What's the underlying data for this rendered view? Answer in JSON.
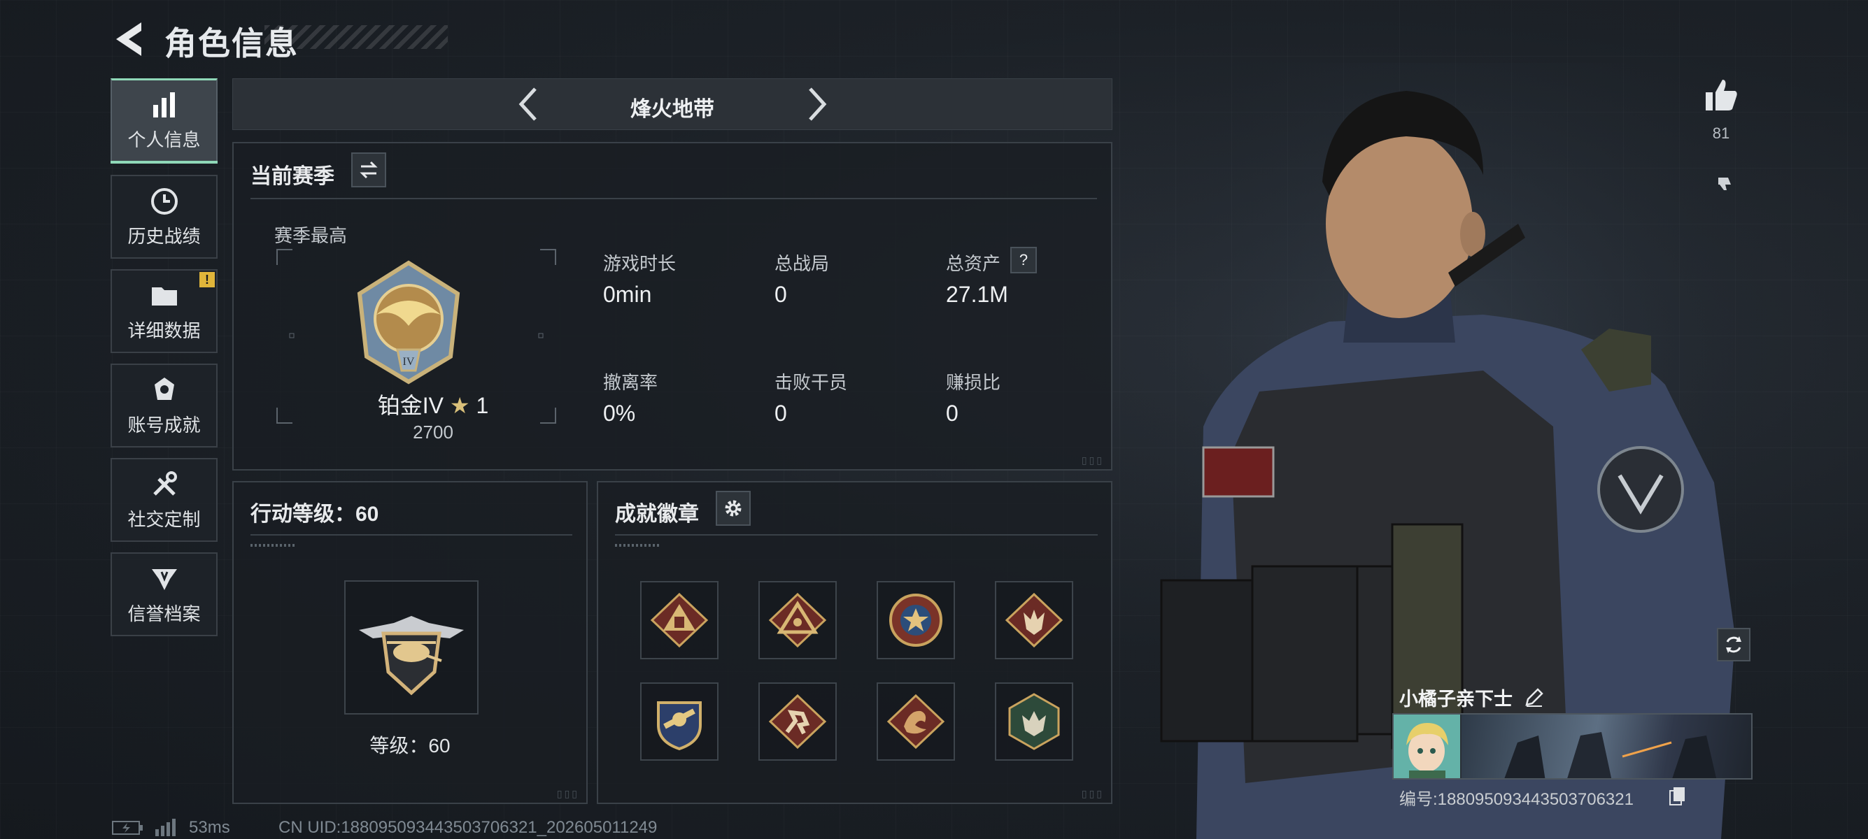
{
  "header": {
    "title": "角色信息"
  },
  "nav": {
    "items": [
      {
        "label": "个人信息",
        "icon": "bar-chart-icon",
        "active": true
      },
      {
        "label": "历史战绩",
        "icon": "history-clock-icon",
        "active": false
      },
      {
        "label": "详细数据",
        "icon": "folder-icon",
        "active": false,
        "badge": "!"
      },
      {
        "label": "账号成就",
        "icon": "achievement-icon",
        "active": false
      },
      {
        "label": "社交定制",
        "icon": "tools-icon",
        "active": false
      },
      {
        "label": "信誉档案",
        "icon": "reputation-icon",
        "active": false
      }
    ]
  },
  "mode": {
    "title": "烽火地带"
  },
  "season": {
    "title": "当前赛季",
    "highest_label": "赛季最高",
    "rank_name": "铂金IV",
    "rank_stars": "1",
    "rank_score": "2700",
    "stats": [
      {
        "label": "游戏时长",
        "value": "0min"
      },
      {
        "label": "总战局",
        "value": "0"
      },
      {
        "label": "总资产",
        "value": "27.1M",
        "help": "?"
      },
      {
        "label": "撤离率",
        "value": "0%"
      },
      {
        "label": "击败干员",
        "value": "0"
      },
      {
        "label": "赚损比",
        "value": "0"
      }
    ]
  },
  "action_level": {
    "title": "行动等级：60",
    "level_text": "等级：60"
  },
  "achievements": {
    "title": "成就徽章",
    "badges": [
      "triangle-badge-icon",
      "triangle-eye-badge-icon",
      "star-medal-badge-icon",
      "wolf-diamond-badge-icon",
      "shield-badge-icon",
      "runner-diamond-badge-icon",
      "dragon-diamond-badge-icon",
      "hex-wolf-badge-icon"
    ]
  },
  "profile": {
    "likes": "81",
    "name": "小橘子亲下士",
    "id_text": "编号:1880950934435037063​21"
  },
  "status_bar": {
    "ping": "53ms",
    "uid": "CN UID:1880950934435037063​21_202605011249"
  },
  "colors": {
    "accent": "#8fd8b8",
    "badge_yellow": "#e0b53a",
    "panel_border": "#3a4148"
  }
}
